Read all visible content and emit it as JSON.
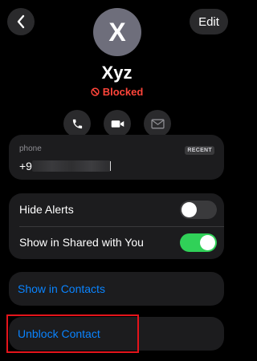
{
  "header": {
    "edit_label": "Edit"
  },
  "contact": {
    "initial": "X",
    "name": "Xyz",
    "status": "Blocked"
  },
  "actions": [
    {
      "icon": "phone-icon"
    },
    {
      "icon": "video-icon"
    },
    {
      "icon": "mail-icon"
    }
  ],
  "phone": {
    "label": "phone",
    "badge": "RECENT",
    "value_prefix": "+9",
    "value_redacted": true
  },
  "toggles": [
    {
      "label": "Hide Alerts",
      "on": false
    },
    {
      "label": "Show in Shared with You",
      "on": true
    }
  ],
  "links": {
    "show_in_contacts": "Show in Contacts",
    "unblock_contact": "Unblock Contact"
  },
  "colors": {
    "accent": "#0a84ff",
    "blocked": "#ff453a",
    "toggle_on": "#30d158",
    "toggle_off": "#3a3a3c",
    "highlight": "#e4141b"
  }
}
